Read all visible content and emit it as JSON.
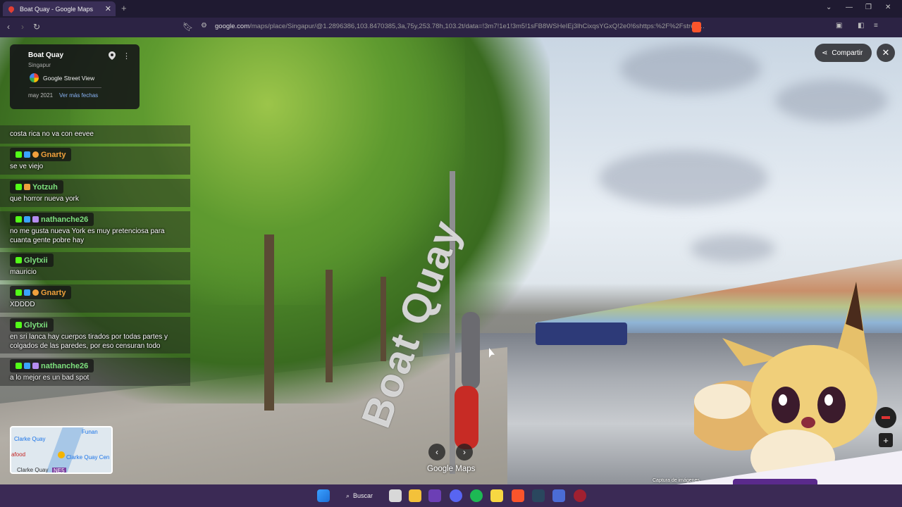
{
  "browser": {
    "tab_title": "Boat Quay - Google Maps",
    "tab_close": "✕",
    "new_tab": "+",
    "url_lead": "google.com",
    "url_rest": "/maps/place/Singapur/@1.2896386,103.8470385,3a,75y,253.78h,103.2t/data=!3m7!1e1!3m5!1sFB8WSHeIEj3lhCixqsYGxQ!2e0!6shttps:%2F%2Fstree…"
  },
  "place_card": {
    "title": "Boat Quay",
    "subtitle": "Singapur",
    "source": "Google Street View",
    "date": "may 2021",
    "more_dates": "Ver más fechas"
  },
  "controls": {
    "share_label": "Compartir",
    "close_label": "✕",
    "prev_label": "‹",
    "next_label": "›",
    "zoom_in": "+",
    "logo": "Google Maps",
    "capture": "Captura de imágenes ..."
  },
  "scene": {
    "road_label": "Boat Quay"
  },
  "chat": [
    {
      "user": "",
      "user_color": "",
      "text": "costa rica no va con eevee"
    },
    {
      "user": "Gnarty",
      "user_color": "#f0a03c",
      "text": "se ve viejo"
    },
    {
      "user": "Yotzuh",
      "user_color": "#7de07d",
      "text": "que horror nueva york"
    },
    {
      "user": "nathanche26",
      "user_color": "#7de07d",
      "text": "no me gusta nueva York es muy pretenciosa para cuanta gente pobre hay"
    },
    {
      "user": "Glytxii",
      "user_color": "#7de07d",
      "text": "mauricio"
    },
    {
      "user": "Gnarty",
      "user_color": "#f0a03c",
      "text": "XDDDD"
    },
    {
      "user": "Glytxii",
      "user_color": "#7de07d",
      "text": "en sri lanca hay cuerpos tirados por todas partes y colgados de las paredes, por eso censuran todo"
    },
    {
      "user": "nathanche26",
      "user_color": "#7de07d",
      "text": "a lo mejor es un bad spot"
    }
  ],
  "minimap": {
    "labels": [
      "Clarke Quay",
      "Funan",
      "Clarke Quay Cen",
      "afood",
      "Clarke Quay",
      "NE5"
    ]
  },
  "taskbar": {
    "search_label": "Buscar"
  }
}
